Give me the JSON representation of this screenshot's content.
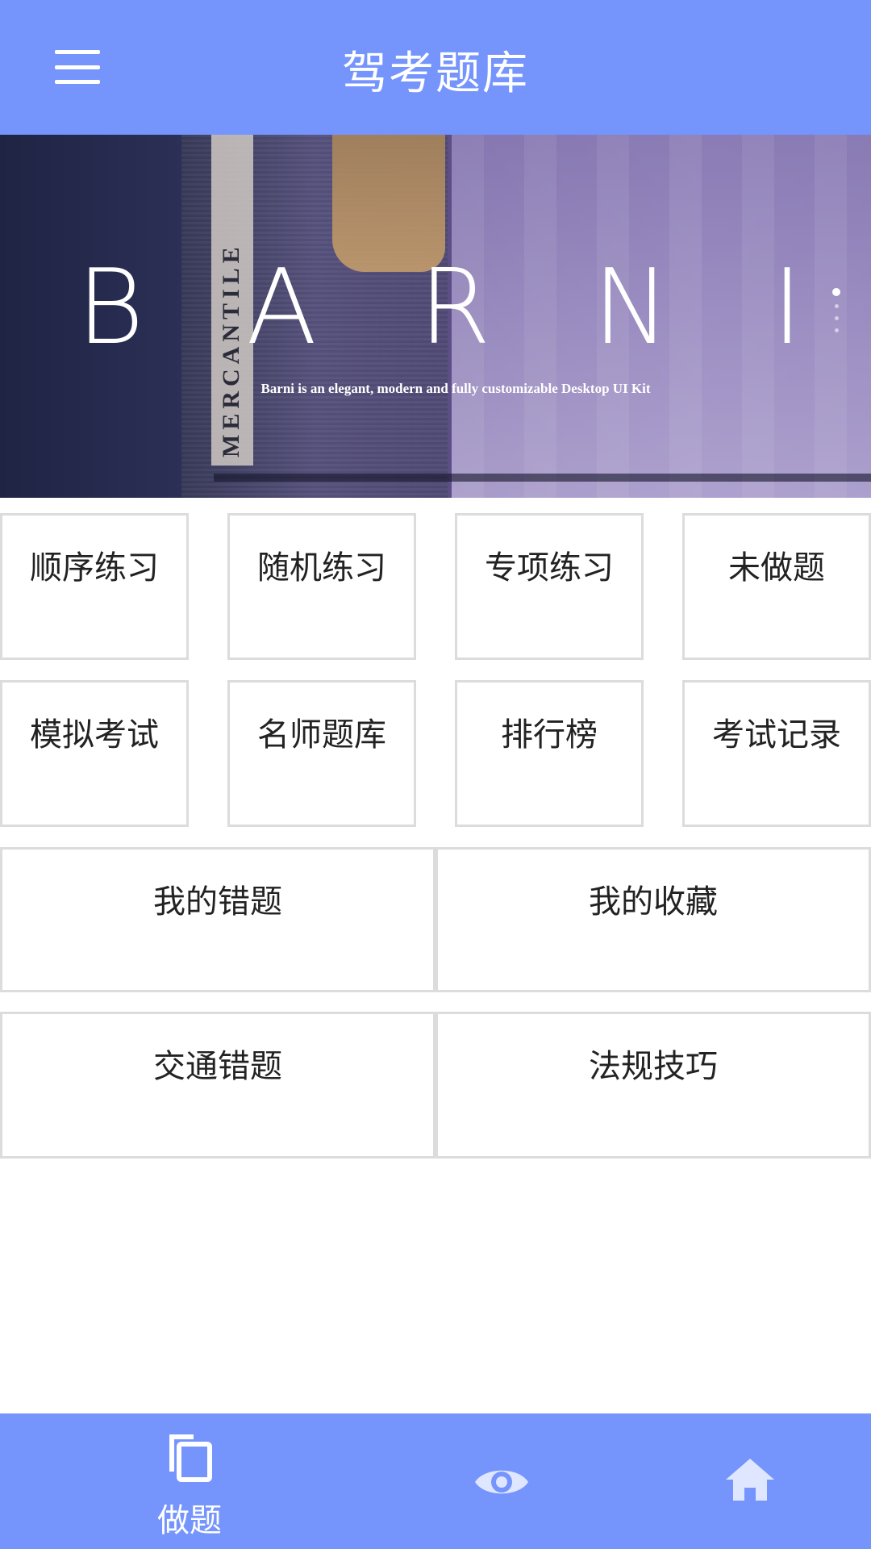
{
  "header": {
    "title": "驾考题库",
    "menu_icon": "menu-icon"
  },
  "banner": {
    "brand_letters": [
      "B",
      "A",
      "R",
      "N",
      "I"
    ],
    "tagline": "Barni is an elegant, modern and fully customizable Desktop UI Kit",
    "vertical_text": "MERCANTILE",
    "slide_count": 4,
    "active_slide": 1
  },
  "menu": {
    "row1": [
      "顺序练习",
      "随机练习",
      "专项练习",
      "未做题"
    ],
    "row2": [
      "模拟考试",
      "名师题库",
      "排行榜",
      "考试记录"
    ],
    "row3": [
      "我的错题",
      "我的收藏"
    ],
    "row4": [
      "交通错题",
      "法规技巧"
    ]
  },
  "bottom_nav": {
    "items": [
      {
        "icon": "copy-icon",
        "label": "做题"
      },
      {
        "icon": "eye-icon",
        "label": ""
      },
      {
        "icon": "home-icon",
        "label": ""
      }
    ]
  },
  "colors": {
    "primary": "#7595fd",
    "cell_border": "#dcdcdc",
    "text": "#222222"
  }
}
